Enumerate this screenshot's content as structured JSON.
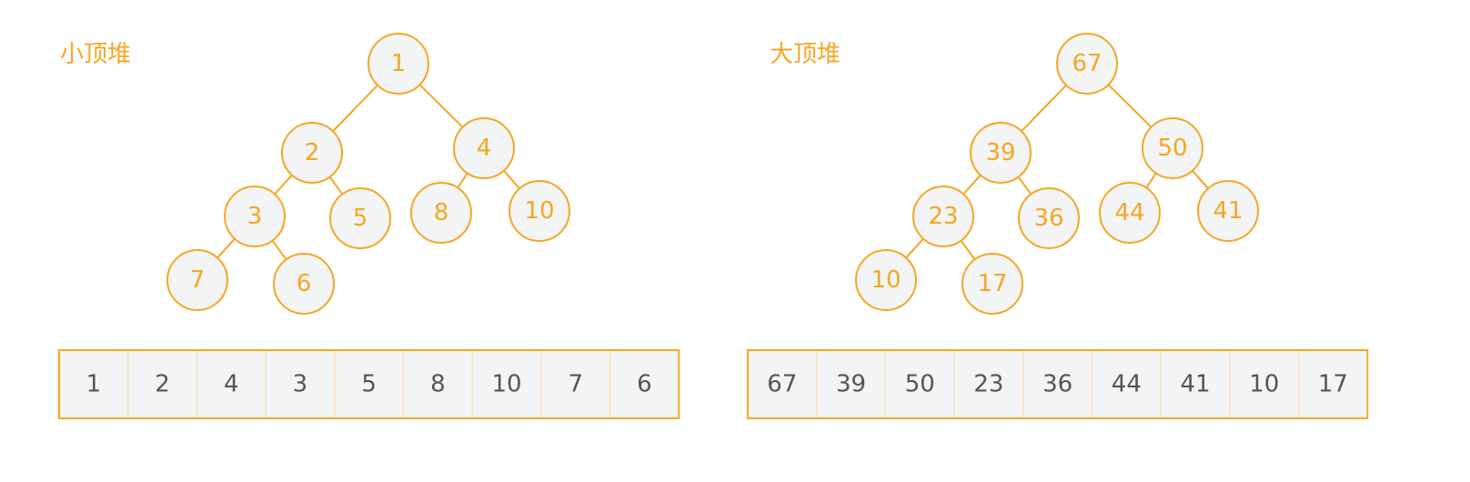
{
  "colors": {
    "accent": "#f5a623",
    "node_fill": "#f2f4f5",
    "cell_text": "#555555",
    "cell_divider": "#fbe3bb"
  },
  "heaps": [
    {
      "id": "min-heap",
      "title": "小顶堆",
      "nodes": [
        "1",
        "2",
        "4",
        "3",
        "5",
        "8",
        "10",
        "7",
        "6"
      ],
      "array": [
        "1",
        "2",
        "4",
        "3",
        "5",
        "8",
        "10",
        "7",
        "6"
      ]
    },
    {
      "id": "max-heap",
      "title": "大顶堆",
      "nodes": [
        "67",
        "39",
        "50",
        "23",
        "36",
        "44",
        "41",
        "10",
        "17"
      ],
      "array": [
        "67",
        "39",
        "50",
        "23",
        "36",
        "44",
        "41",
        "10",
        "17"
      ]
    }
  ]
}
